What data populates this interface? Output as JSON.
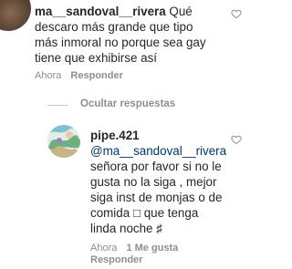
{
  "comment": {
    "username": "ma__sandoval__rivera",
    "lines": [
      "Qué",
      "descaro más grande que tipo",
      "más inmoral no porque sea gay",
      "tiene que exhibirse así"
    ],
    "time": "Ahora",
    "reply_label": "Responder"
  },
  "thread": {
    "hide_replies_label": "Ocultar respuestas"
  },
  "reply": {
    "username": "pipe.421",
    "mention": "@ma__sandoval__rivera",
    "lines": [
      "señora por favor si no le",
      "gusta no la siga , mejor",
      "siga inst de monjas o de",
      "comida □ que tenga",
      "linda noche ♯"
    ],
    "time": "Ahora",
    "likes": "1 Me gusta",
    "reply_label": "Responder"
  },
  "icons": {
    "heart": "heart-icon",
    "divider": "divider-line"
  },
  "colors": {
    "text": "#262626",
    "muted": "#8e8e8e",
    "mention": "#00376b"
  }
}
